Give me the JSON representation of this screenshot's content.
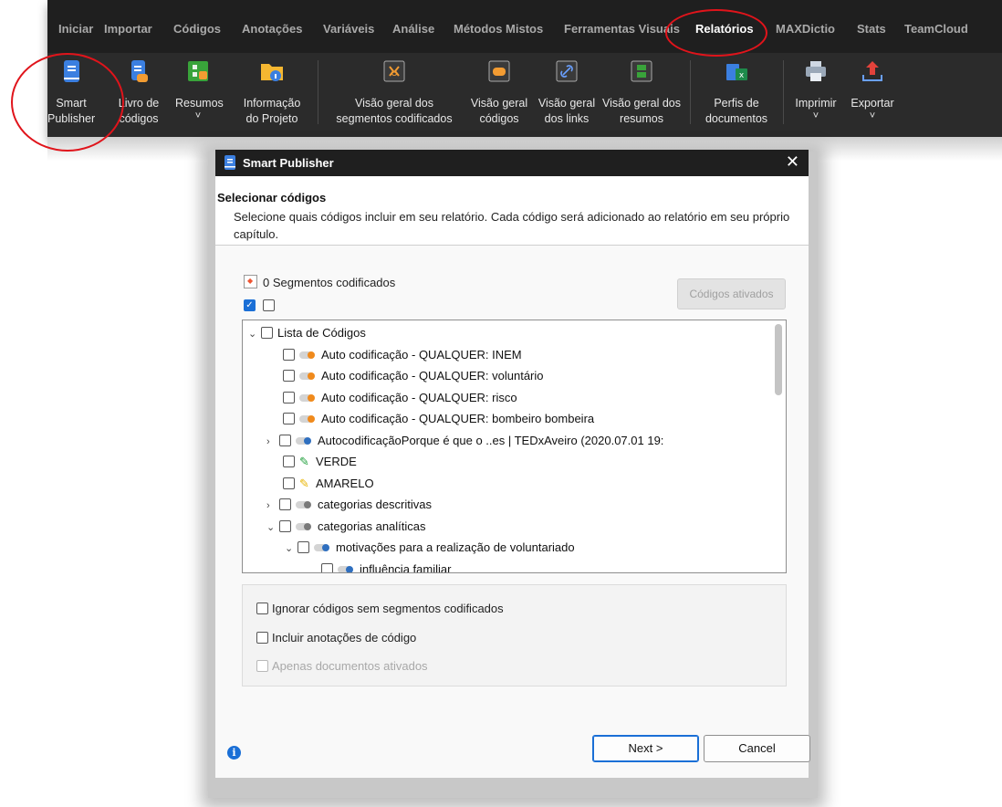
{
  "ribbon": {
    "menu": [
      "Iniciar",
      "Importar",
      "Códigos",
      "Anotações",
      "Variáveis",
      "Análise",
      "Métodos Mistos",
      "Ferramentas Visuais",
      "Relatórios",
      "MAXDictio",
      "Stats",
      "TeamCloud"
    ],
    "active_menu": "Relatórios",
    "buttons": [
      {
        "line1": "Smart",
        "line2": "Publisher",
        "icon": "smart-publisher-icon"
      },
      {
        "line1": "Livro de",
        "line2": "códigos",
        "icon": "codebook-icon"
      },
      {
        "line1": "Resumos",
        "line2": "˅",
        "icon": "summaries-icon"
      },
      {
        "line1": "Informação",
        "line2": "do Projeto",
        "icon": "project-info-icon"
      },
      {
        "line1": "Visão geral dos",
        "line2": "segmentos codificados",
        "icon": "coded-segments-icon"
      },
      {
        "line1": "Visão geral",
        "line2": "códigos",
        "icon": "codes-overview-icon"
      },
      {
        "line1": "Visão geral",
        "line2": "dos links",
        "icon": "links-overview-icon"
      },
      {
        "line1": "Visão geral dos",
        "line2": "resumos",
        "icon": "summaries-overview-icon"
      },
      {
        "line1": "Perfis de",
        "line2": "documentos",
        "icon": "document-profiles-icon"
      },
      {
        "line1": "Imprimir",
        "line2": "˅",
        "icon": "print-icon"
      },
      {
        "line1": "Exportar",
        "line2": "˅",
        "icon": "export-icon"
      }
    ]
  },
  "dialog": {
    "title": "Smart Publisher",
    "close": "✕",
    "header_title": "Selecionar códigos",
    "header_desc": "Selecione quais códigos incluir em seu relatório. Cada código será adicionado ao relatório em seu próprio capítulo.",
    "segments_label": "0 Segmentos codificados",
    "activated_button": "Códigos ativados",
    "tree": [
      {
        "label": "Lista de Códigos",
        "arrow": "⌄",
        "icon": "none"
      },
      {
        "label": "Auto codificação - QUALQUER: INEM",
        "arrow": "",
        "icon": "orange"
      },
      {
        "label": "Auto codificação - QUALQUER: voluntário",
        "arrow": "",
        "icon": "orange"
      },
      {
        "label": "Auto codificação - QUALQUER: risco",
        "arrow": "",
        "icon": "orange"
      },
      {
        "label": "Auto codificação - QUALQUER: bombeiro bombeira",
        "arrow": "",
        "icon": "orange"
      },
      {
        "label": "AutocodificaçãoPorque é que o ..es | TEDxAveiro (2020.07.01 19:",
        "arrow": "›",
        "icon": "blue"
      },
      {
        "label": "VERDE",
        "arrow": "",
        "icon": "green-pen"
      },
      {
        "label": "AMARELO",
        "arrow": "",
        "icon": "yellow-pen"
      },
      {
        "label": "categorias descritivas",
        "arrow": "›",
        "icon": "grey"
      },
      {
        "label": "categorias analíticas",
        "arrow": "⌄",
        "icon": "grey"
      },
      {
        "label": "motivações para a realização de voluntariado",
        "arrow": "⌄",
        "icon": "blue"
      },
      {
        "label": "influência familiar",
        "arrow": "",
        "icon": "blue"
      }
    ],
    "options": [
      {
        "label": "Ignorar códigos sem segmentos codificados",
        "disabled": false
      },
      {
        "label": "Incluir anotações de código",
        "disabled": false
      },
      {
        "label": "Apenas documentos ativados",
        "disabled": true
      }
    ],
    "next_label": "Next >",
    "cancel_label": "Cancel",
    "info_icon": "i"
  },
  "colors": {
    "accent": "#1a6fd6",
    "highlight": "#e0141b",
    "ribbon": "#2b2b2b"
  }
}
